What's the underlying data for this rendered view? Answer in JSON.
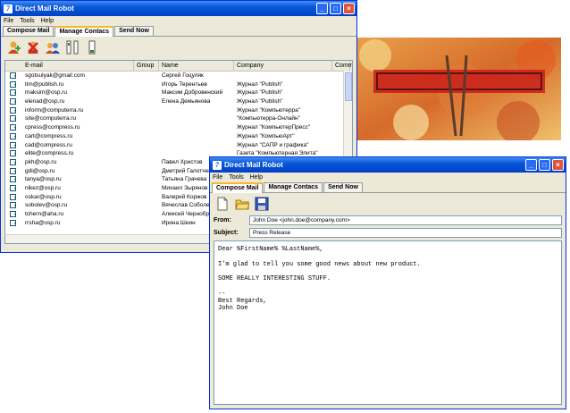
{
  "app": {
    "title": "Direct Mail Robot",
    "menu": [
      "File",
      "Tools",
      "Help"
    ],
    "tabs": [
      "Compose Mail",
      "Manage Contacs",
      "Send Now"
    ]
  },
  "contacts": {
    "columns": [
      "E-mail",
      "Group",
      "Name",
      "Company",
      "Comm"
    ],
    "rows": [
      {
        "email": "sgotsulyak@gmail.com",
        "group": "",
        "name": "Сергей Гоцуляк",
        "company": ""
      },
      {
        "email": "tim@publish.ru",
        "group": "",
        "name": "Игорь Терентьев",
        "company": "Журнал \"Publish\""
      },
      {
        "email": "maksim@osp.ru",
        "group": "",
        "name": "Максим Добровенский",
        "company": "Журнал \"Publish\""
      },
      {
        "email": "elenad@osp.ru",
        "group": "",
        "name": "Елена Демьянова",
        "company": "Журнал \"Publish\""
      },
      {
        "email": "inform@computerra.ru",
        "group": "",
        "name": "",
        "company": "Журнал \"Компьютерра\""
      },
      {
        "email": "site@computerra.ru",
        "group": "",
        "name": "",
        "company": "\"Компьютерра-Онлайн\""
      },
      {
        "email": "cpress@compress.ru",
        "group": "",
        "name": "",
        "company": "Журнал \"КомпьютерПресс\""
      },
      {
        "email": "cart@compress.ru",
        "group": "",
        "name": "",
        "company": "Журнал \"КомпьюАрт\""
      },
      {
        "email": "cad@compress.ru",
        "group": "",
        "name": "",
        "company": "Журнал \"САПР и графика\""
      },
      {
        "email": "elite@compress.ru",
        "group": "",
        "name": "",
        "company": "Газета \"Компьютерная Элита\""
      },
      {
        "email": "pkh@osp.ru",
        "group": "",
        "name": "Павел Христов",
        "company": ""
      },
      {
        "email": "gdi@osp.ru",
        "group": "",
        "name": "Дмитрий Галотченко",
        "company": ""
      },
      {
        "email": "tanya@osp.ru",
        "group": "",
        "name": "Татьяна Грачева",
        "company": ""
      },
      {
        "email": "nikez@osp.ru",
        "group": "",
        "name": "Михаил Зырянов",
        "company": ""
      },
      {
        "email": "oskar@osp.ru",
        "group": "",
        "name": "Валерий Коржов",
        "company": ""
      },
      {
        "email": "sobolev@osp.ru",
        "group": "",
        "name": "Вячеслав Соболев",
        "company": ""
      },
      {
        "email": "tchern@aha.ru",
        "group": "",
        "name": "Алексей Черноброво",
        "company": ""
      },
      {
        "email": "rrsha@osp.ru",
        "group": "",
        "name": "Ирина Шеин",
        "company": ""
      }
    ]
  },
  "compose": {
    "from_label": "From:",
    "from_value": "John Doe <john.doe@company.com>",
    "subject_label": "Subject:",
    "subject_value": "Press Release",
    "body": [
      "Dear %FirstName% %LastName%,",
      "",
      "I'm glad to tell you some good news about new product.",
      "",
      "SOME REALLY INTERESTING STUFF.",
      "",
      "--",
      "Best Regards,",
      "John Doe"
    ]
  },
  "colors": {
    "titlebar": "#0a56d6",
    "accent_tab": "#f5b82a",
    "window_bg": "#ece9d8"
  }
}
